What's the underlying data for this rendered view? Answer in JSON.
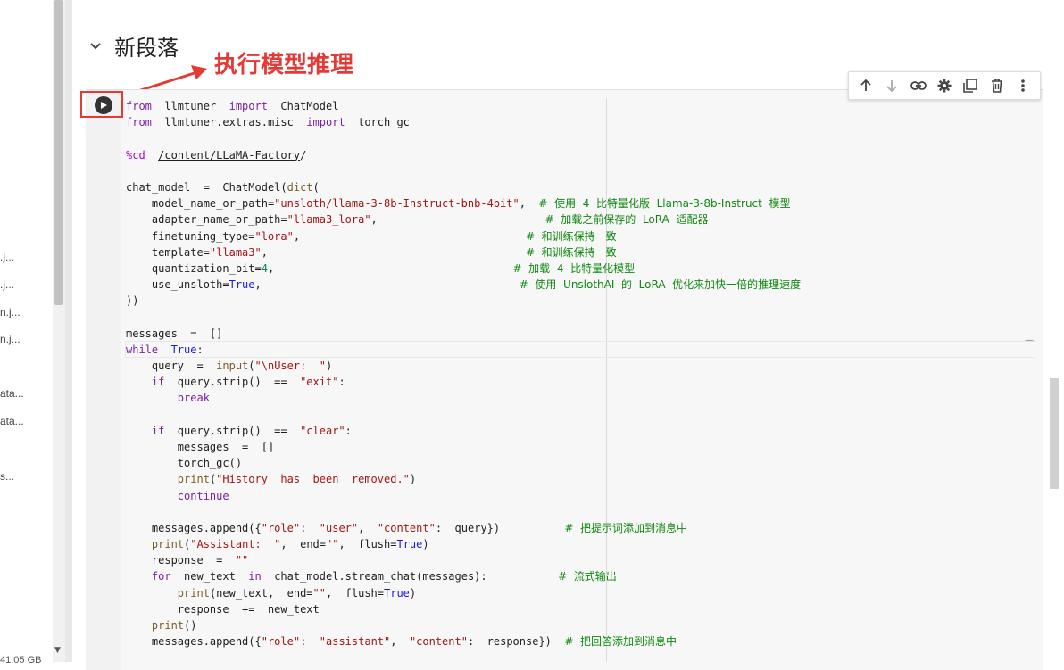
{
  "file_panel": {
    "items": [
      ".j...",
      ".j...",
      "n.j...",
      "n.j...",
      "ata...",
      "ata...",
      "s..."
    ],
    "disk_label": "41.05 GB"
  },
  "section": {
    "title": "新段落"
  },
  "annotation": {
    "text": "执行模型推理",
    "color": "#e53935"
  },
  "toolbar": {
    "buttons": [
      "arrow-up-icon",
      "arrow-down-icon",
      "link-icon",
      "gear-icon",
      "mirror-cell-icon",
      "trash-icon",
      "more-vert-icon"
    ]
  },
  "code": {
    "l1_a": "from",
    "l1_b": "  llmtuner  ",
    "l1_c": "import",
    "l1_d": "  ChatModel",
    "l2_a": "from",
    "l2_b": "  llmtuner.extras.misc  ",
    "l2_c": "import",
    "l2_d": "  torch_gc",
    "l4_a": "%cd",
    "l4_b": "  ",
    "l4_c": "/content/LLaMA-Factory",
    "l4_d": "/",
    "l6_a": "chat_model  =  ChatModel(",
    "l6_b": "dict",
    "l6_c": "(",
    "l7_a": "    model_name_or_path=",
    "l7_b": "\"unsloth/llama-3-8b-Instruct-bnb-4bit\"",
    "l7_c": ",  ",
    "l7_d": "#  使用  4  比特量化版  Llama-3-8b-Instruct  模型",
    "l8_a": "    adapter_name_or_path=",
    "l8_b": "\"llama3_lora\"",
    "l8_c": ",                          ",
    "l8_d": "#  加载之前保存的  LoRA  适配器",
    "l9_a": "    finetuning_type=",
    "l9_b": "\"lora\"",
    "l9_c": ",                                   ",
    "l9_d": "#  和训练保持一致",
    "l10_a": "    template=",
    "l10_b": "\"llama3\"",
    "l10_c": ",                                        ",
    "l10_d": "#  和训练保持一致",
    "l11_a": "    quantization_bit=",
    "l11_b": "4",
    "l11_c": ",                                     ",
    "l11_d": "#  加载  4  比特量化模型",
    "l12_a": "    use_unsloth=",
    "l12_b": "True",
    "l12_c": ",                                        ",
    "l12_d": "#  使用  UnslothAI  的  LoRA  优化来加快一倍的推理速度",
    "l13": "))",
    "l15": "messages  =  []",
    "l16_a": "while",
    "l16_b": "  ",
    "l16_c": "True",
    "l16_d": ":",
    "l17_a": "    query  =  ",
    "l17_b": "input",
    "l17_c": "(",
    "l17_d": "\"\\nUser:  \"",
    "l17_e": ")",
    "l18_a": "    ",
    "l18_b": "if",
    "l18_c": "  query.strip()  ==  ",
    "l18_d": "\"exit\"",
    "l18_e": ":",
    "l19_a": "        ",
    "l19_b": "break",
    "l21_a": "    ",
    "l21_b": "if",
    "l21_c": "  query.strip()  ==  ",
    "l21_d": "\"clear\"",
    "l21_e": ":",
    "l22": "        messages  =  []",
    "l23": "        torch_gc()",
    "l24_a": "        ",
    "l24_b": "print",
    "l24_c": "(",
    "l24_d": "\"History  has  been  removed.\"",
    "l24_e": ")",
    "l25_a": "        ",
    "l25_b": "continue",
    "l27_a": "    messages.append({",
    "l27_b": "\"role\"",
    "l27_c": ":  ",
    "l27_d": "\"user\"",
    "l27_e": ",  ",
    "l27_f": "\"content\"",
    "l27_g": ":  query})          ",
    "l27_h": "#  把提示词添加到消息中",
    "l28_a": "    ",
    "l28_b": "print",
    "l28_c": "(",
    "l28_d": "\"Assistant:  \"",
    "l28_e": ",  end=",
    "l28_f": "\"\"",
    "l28_g": ",  flush=",
    "l28_h": "True",
    "l28_i": ")",
    "l29_a": "    response  =  ",
    "l29_b": "\"\"",
    "l30_a": "    ",
    "l30_b": "for",
    "l30_c": "  new_text  ",
    "l30_d": "in",
    "l30_e": "  chat_model.stream_chat(messages):           ",
    "l30_f": "#  流式输出",
    "l31_a": "        ",
    "l31_b": "print",
    "l31_c": "(new_text,  end=",
    "l31_d": "\"\"",
    "l31_e": ",  flush=",
    "l31_f": "True",
    "l31_g": ")",
    "l32": "        response  +=  new_text",
    "l33_a": "    ",
    "l33_b": "print",
    "l33_c": "()",
    "l34_a": "    messages.append({",
    "l34_b": "\"role\"",
    "l34_c": ":  ",
    "l34_d": "\"assistant\"",
    "l34_e": ",  ",
    "l34_f": "\"content\"",
    "l34_g": ":  response})  ",
    "l34_h": "#  把回答添加到消息中"
  }
}
